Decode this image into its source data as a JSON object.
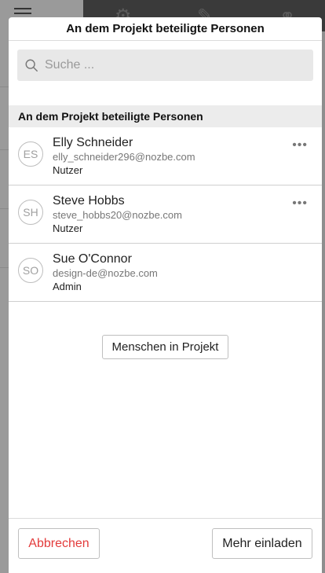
{
  "modal": {
    "title": "An dem Projekt beteiligte Personen",
    "search": {
      "value": "",
      "placeholder": "Suche ..."
    },
    "section_header": "An dem Projekt beteiligte Personen",
    "people": [
      {
        "initials": "ES",
        "name": "Elly Schneider",
        "email": "elly_schneider296@nozbe.com",
        "role": "Nutzer",
        "has_more": true
      },
      {
        "initials": "SH",
        "name": "Steve Hobbs",
        "email": "steve_hobbs20@nozbe.com",
        "role": "Nutzer",
        "has_more": true
      },
      {
        "initials": "SO",
        "name": "Sue O'Connor",
        "email": "design-de@nozbe.com",
        "role": "Admin",
        "has_more": false
      }
    ],
    "people_in_project_label": "Menschen in Projekt",
    "footer": {
      "cancel_label": "Abbrechen",
      "invite_label": "Mehr einladen"
    },
    "more_glyph": "•••"
  },
  "colors": {
    "cancel_text": "#e33b3b",
    "overlay": "#8c8c8c"
  },
  "icons": {
    "search": "search-icon",
    "more": "more-horizontal-icon"
  }
}
